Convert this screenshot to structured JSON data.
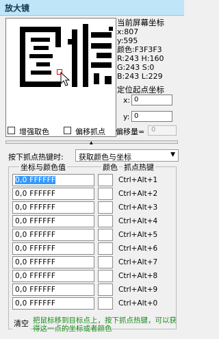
{
  "window": {
    "title": "放大镜"
  },
  "info": {
    "heading": "当前屏幕坐标",
    "x": "x:807",
    "y": "y:595",
    "color": "颜色:F3F3F3",
    "rh": "R:243  H:160",
    "gs": "G:243  S:0",
    "bl": "B:243  L:229"
  },
  "locate": {
    "title": "定位起点坐标",
    "x_label": "x:",
    "x_value": "0",
    "y_label": "y:",
    "y_value": "0"
  },
  "options": {
    "enhance_label": "增强取色",
    "offset_label": "偏移抓点",
    "offset_amount_label": "偏移量=",
    "offset_amount_value": "0"
  },
  "hotkey": {
    "label": "按下抓点热键时:",
    "selected": "获取颜色与坐标"
  },
  "table": {
    "col_coord": "坐标与颜色值",
    "col_color": "颜色",
    "col_hotkey": "抓点热键",
    "rows": [
      {
        "value": "0,0  FFFFFF",
        "hotkey": "Ctrl+Alt+1"
      },
      {
        "value": "0,0  FFFFFF",
        "hotkey": "Ctrl+Alt+2"
      },
      {
        "value": "0,0  FFFFFF",
        "hotkey": "Ctrl+Alt+3"
      },
      {
        "value": "0,0  FFFFFF",
        "hotkey": "Ctrl+Alt+4"
      },
      {
        "value": "0,0  FFFFFF",
        "hotkey": "Ctrl+Alt+5"
      },
      {
        "value": "0,0  FFFFFF",
        "hotkey": "Ctrl+Alt+6"
      },
      {
        "value": "0,0  FFFFFF",
        "hotkey": "Ctrl+Alt+7"
      },
      {
        "value": "0,0  FFFFFF",
        "hotkey": "Ctrl+Alt+8"
      },
      {
        "value": "0,0  FFFFFF",
        "hotkey": "Ctrl+Alt+9"
      },
      {
        "value": "0,0  FFFFFF",
        "hotkey": "Ctrl+Alt+0"
      }
    ]
  },
  "footer": {
    "clear_label": "清空",
    "tip": "把鼠标移到目标点上，按下抓点热键，可以获得这一点的坐标或者颜色"
  },
  "colors": {
    "tip_green": "#1a8c1a",
    "titlebar": "#bfe6f8",
    "selection": "#3399ff"
  },
  "icons": [
    "arrow-cursor-icon",
    "dropdown-arrow-icon"
  ]
}
